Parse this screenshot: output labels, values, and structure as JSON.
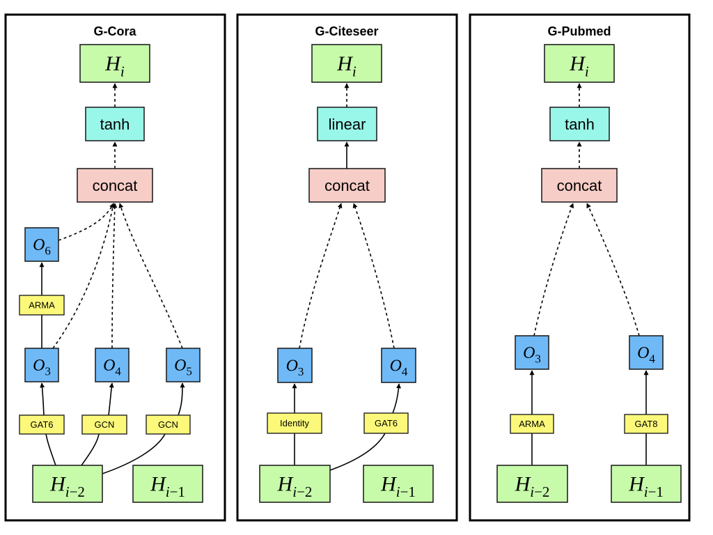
{
  "figure": {
    "panels": [
      {
        "title": "G-Cora",
        "nodes": {
          "out": {
            "type": "state",
            "base": "H",
            "sub": "i"
          },
          "act": {
            "type": "act",
            "label": "tanh"
          },
          "concat": {
            "type": "concat",
            "label": "concat"
          },
          "o6": {
            "type": "op",
            "base": "O",
            "sub": "6"
          },
          "l_arma": {
            "type": "layer",
            "label": "ARMA"
          },
          "o3": {
            "type": "op",
            "base": "O",
            "sub": "3"
          },
          "o4": {
            "type": "op",
            "base": "O",
            "sub": "4"
          },
          "o5": {
            "type": "op",
            "base": "O",
            "sub": "5"
          },
          "l_gat6": {
            "type": "layer",
            "label": "GAT6"
          },
          "l_gcn1": {
            "type": "layer",
            "label": "GCN"
          },
          "l_gcn2": {
            "type": "layer",
            "label": "GCN"
          },
          "hm2": {
            "type": "state",
            "base": "H",
            "sub": "i−2"
          },
          "hm1": {
            "type": "state",
            "base": "H",
            "sub": "i−1"
          }
        },
        "edges": [
          {
            "from": "act",
            "to": "out",
            "style": "dashed"
          },
          {
            "from": "concat",
            "to": "act",
            "style": "dashed"
          },
          {
            "from": "o6",
            "to": "concat",
            "style": "dashed"
          },
          {
            "from": "o3",
            "to": "concat",
            "style": "dashed"
          },
          {
            "from": "o4",
            "to": "concat",
            "style": "dashed"
          },
          {
            "from": "o5",
            "to": "concat",
            "style": "dashed"
          },
          {
            "from": "o3",
            "to": "o6",
            "via": "l_arma",
            "style": "solid"
          },
          {
            "from": "hm2",
            "to": "o3",
            "via": "l_gat6",
            "style": "solid"
          },
          {
            "from": "hm2",
            "to": "o4",
            "via": "l_gcn1",
            "style": "solid"
          },
          {
            "from": "hm2",
            "to": "o5",
            "via": "l_gcn2",
            "style": "solid"
          }
        ]
      },
      {
        "title": "G-Citeseer",
        "nodes": {
          "out": {
            "type": "state",
            "base": "H",
            "sub": "i"
          },
          "act": {
            "type": "act",
            "label": "linear"
          },
          "concat": {
            "type": "concat",
            "label": "concat"
          },
          "o3": {
            "type": "op",
            "base": "O",
            "sub": "3"
          },
          "o4": {
            "type": "op",
            "base": "O",
            "sub": "4"
          },
          "l_identity": {
            "type": "layer",
            "label": "Identity"
          },
          "l_gat6": {
            "type": "layer",
            "label": "GAT6"
          },
          "hm2": {
            "type": "state",
            "base": "H",
            "sub": "i−2"
          },
          "hm1": {
            "type": "state",
            "base": "H",
            "sub": "i−1"
          }
        },
        "edges": [
          {
            "from": "act",
            "to": "out",
            "style": "dashed"
          },
          {
            "from": "concat",
            "to": "act",
            "style": "solid"
          },
          {
            "from": "o3",
            "to": "concat",
            "style": "dashed"
          },
          {
            "from": "o4",
            "to": "concat",
            "style": "dashed"
          },
          {
            "from": "hm2",
            "to": "o3",
            "via": "l_identity",
            "style": "solid"
          },
          {
            "from": "hm2",
            "to": "o4",
            "via": "l_gat6",
            "style": "solid"
          }
        ]
      },
      {
        "title": "G-Pubmed",
        "nodes": {
          "out": {
            "type": "state",
            "base": "H",
            "sub": "i"
          },
          "act": {
            "type": "act",
            "label": "tanh"
          },
          "concat": {
            "type": "concat",
            "label": "concat"
          },
          "o3": {
            "type": "op",
            "base": "O",
            "sub": "3"
          },
          "o4": {
            "type": "op",
            "base": "O",
            "sub": "4"
          },
          "l_arma": {
            "type": "layer",
            "label": "ARMA"
          },
          "l_gat8": {
            "type": "layer",
            "label": "GAT8"
          },
          "hm2": {
            "type": "state",
            "base": "H",
            "sub": "i−2"
          },
          "hm1": {
            "type": "state",
            "base": "H",
            "sub": "i−1"
          }
        },
        "edges": [
          {
            "from": "act",
            "to": "out",
            "style": "dashed"
          },
          {
            "from": "concat",
            "to": "act",
            "style": "dashed"
          },
          {
            "from": "o3",
            "to": "concat",
            "style": "dashed"
          },
          {
            "from": "o4",
            "to": "concat",
            "style": "dashed"
          },
          {
            "from": "hm2",
            "to": "o3",
            "via": "l_arma",
            "style": "solid"
          },
          {
            "from": "hm1",
            "to": "o4",
            "via": "l_gat8",
            "style": "solid"
          }
        ]
      }
    ]
  }
}
